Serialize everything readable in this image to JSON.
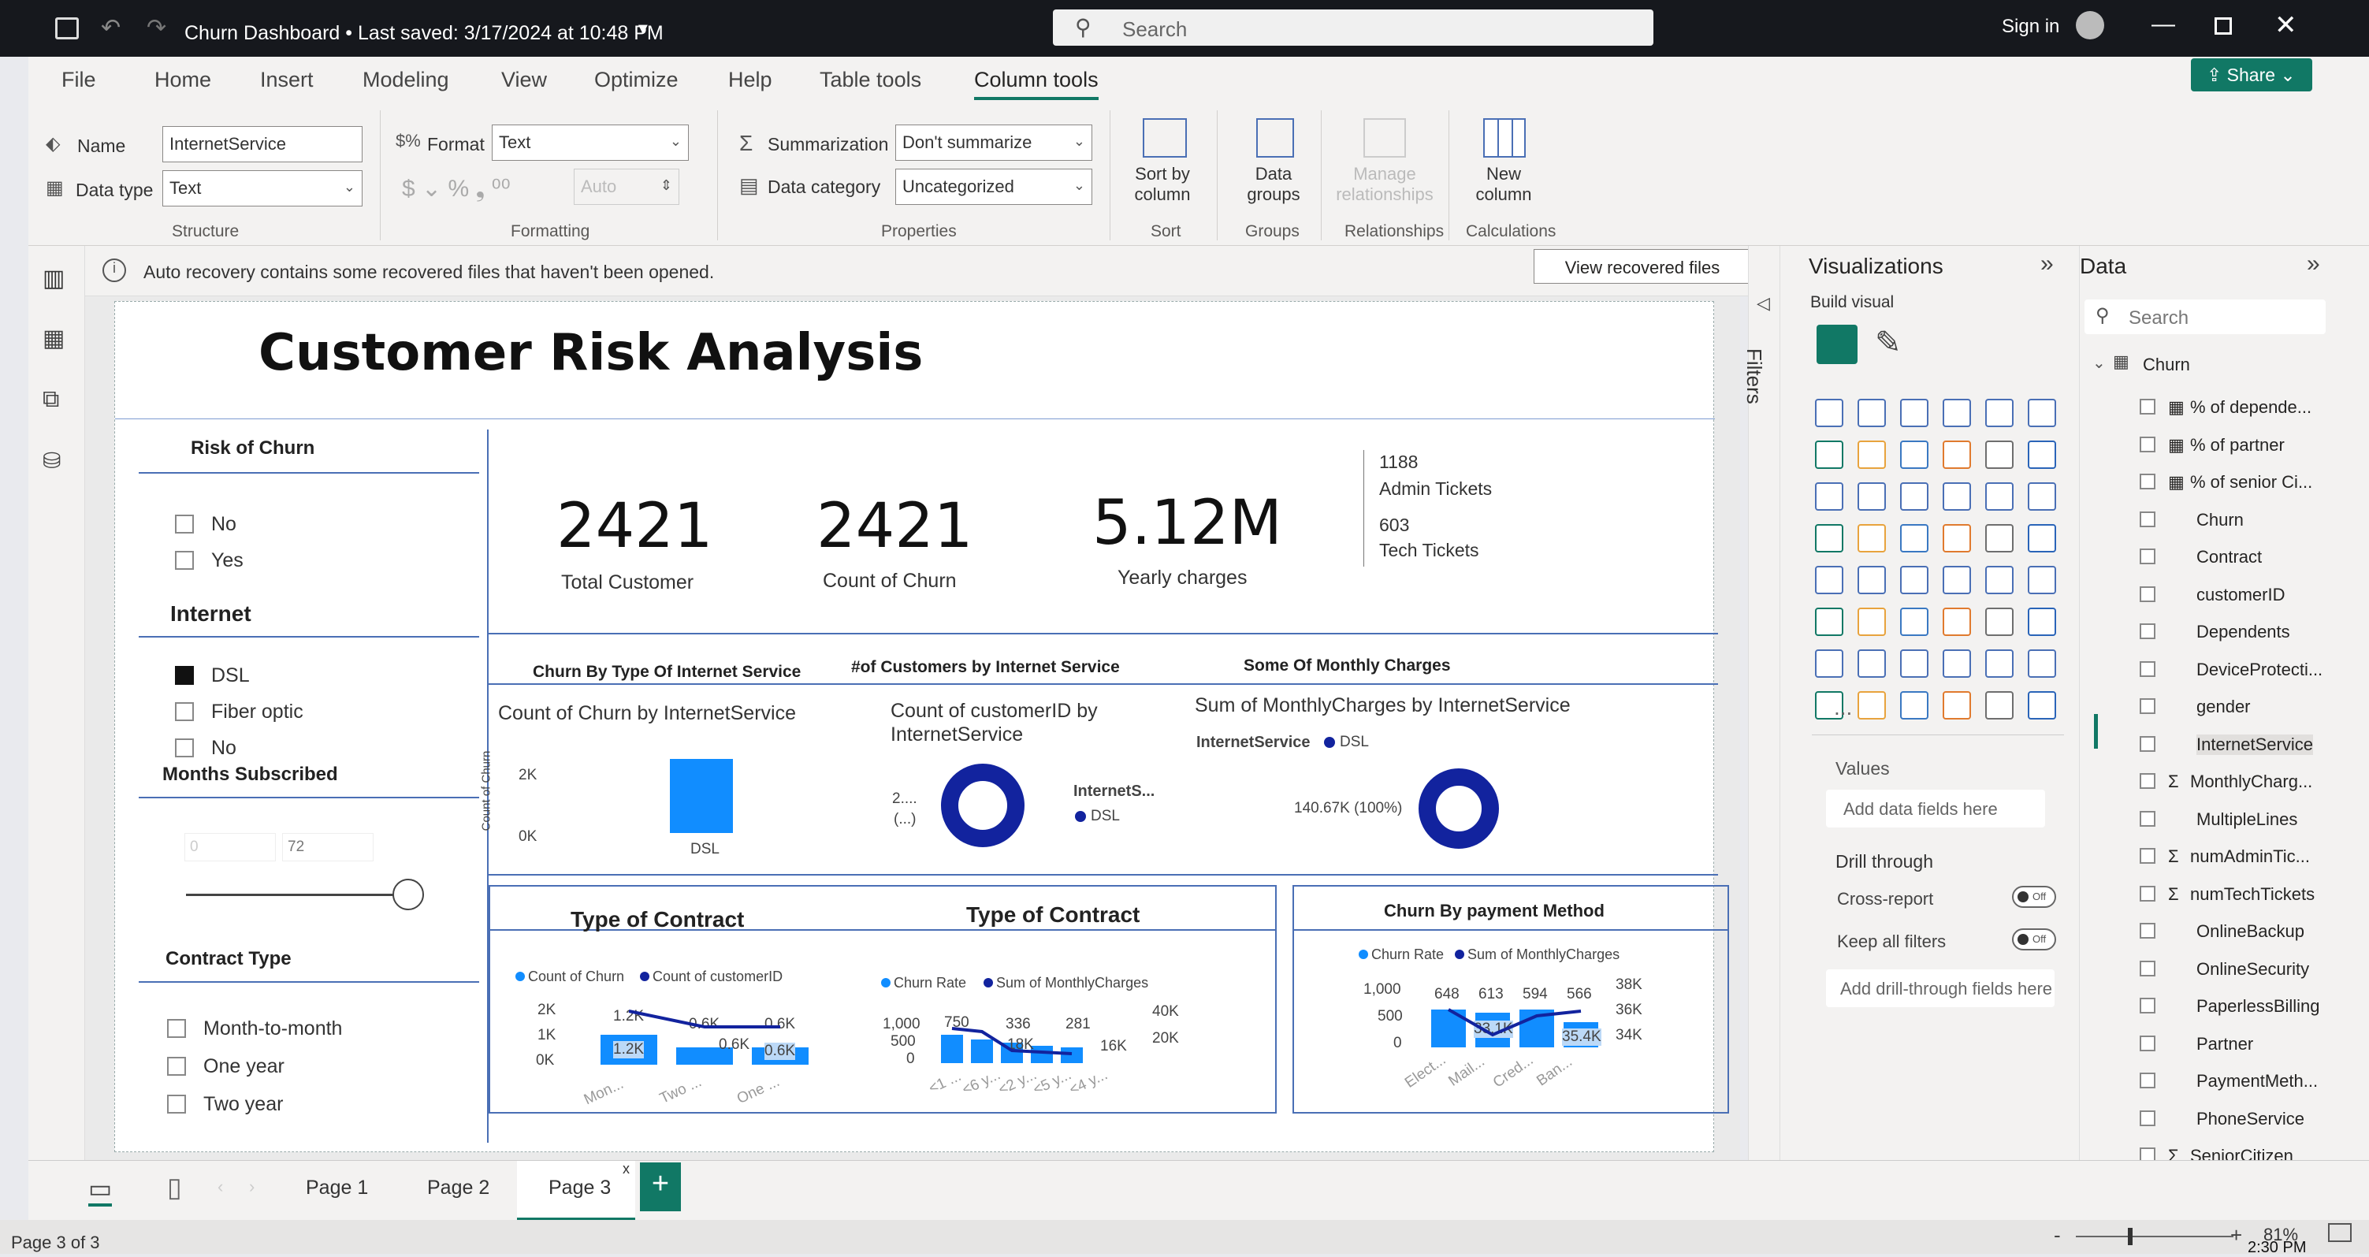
{
  "window": {
    "title": "Churn Dashboard • Last saved: 3/17/2024 at 10:48 PM",
    "search_placeholder": "Search",
    "sign_in": "Sign in",
    "share": "Share"
  },
  "ribbon": {
    "tabs": [
      "File",
      "Home",
      "Insert",
      "Modeling",
      "View",
      "Optimize",
      "Help",
      "Table tools",
      "Column tools"
    ],
    "name_label": "Name",
    "name_value": "InternetService",
    "datatype_label": "Data type",
    "datatype_value": "Text",
    "format_label": "Format",
    "format_value": "Text",
    "auto_value": "Auto",
    "summarization_label": "Summarization",
    "summarization_value": "Don't summarize",
    "category_label": "Data category",
    "category_value": "Uncategorized",
    "sort_label": "Sort by column",
    "groups_label": "Data groups",
    "relationships_label": "Manage relationships",
    "newcol_label": "New column",
    "group_labels": [
      "Structure",
      "Formatting",
      "Properties",
      "Sort",
      "Groups",
      "Relationships",
      "Calculations"
    ]
  },
  "infobar": {
    "message": "Auto recovery contains some recovered files that haven't been opened.",
    "button": "View recovered files"
  },
  "report": {
    "title": "Customer Risk Analysis",
    "slicers": {
      "risk_title": "Risk of Churn",
      "risk_items": [
        "No",
        "Yes"
      ],
      "internet_title": "Internet",
      "internet_items": [
        "DSL",
        "Fiber optic",
        "No"
      ],
      "months_title": "Months Subscribed",
      "months_min": "0",
      "months_max": "72",
      "contract_title": "Contract Type",
      "contract_items": [
        "Month-to-month",
        "One year",
        "Two year"
      ]
    },
    "kpis": {
      "total_customer_value": "2421",
      "total_customer_label": "Total Customer",
      "count_churn_value": "2421",
      "count_churn_label": "Count of Churn",
      "yearly_value": "5.12M",
      "yearly_label": "Yearly charges",
      "admin_value": "1188",
      "admin_label": "Admin Tickets",
      "tech_value": "603",
      "tech_label": "Tech Tickets"
    },
    "section_titles": {
      "churn_internet": "Churn By Type Of Internet Service",
      "customers_internet": "#of Customers by Internet Service",
      "monthly_charges": "Some Of Monthly Charges",
      "contract1": "Type of Contract",
      "contract2": "Type of Contract",
      "payment": "Churn By payment Method"
    },
    "visual1": {
      "title": "Count of Churn by InternetService",
      "ylabel": "Count of Churn",
      "ticks": [
        "2K",
        "0K"
      ],
      "category": "DSL"
    },
    "visual2": {
      "title": "Count of customerID by InternetService",
      "left_label": "2....",
      "left_sub": "(...)",
      "legend_title": "InternetS...",
      "legend_item": "DSL"
    },
    "visual3": {
      "title": "Sum of MonthlyCharges by InternetService",
      "legend_title": "InternetService",
      "legend_item": "DSL",
      "value_label": "140.67K (100%)"
    },
    "visual4": {
      "legend": [
        "Count of Churn",
        "Count of customerID"
      ],
      "yticks": [
        "2K",
        "1K",
        "0K"
      ],
      "top_labels": [
        "1.2K",
        "0.6K",
        "0.6K"
      ],
      "bar_labels": [
        "1.2K",
        "0.6K",
        "0.6K"
      ],
      "categories": [
        "Mon...",
        "Two ...",
        "One ..."
      ]
    },
    "visual5": {
      "legend": [
        "Churn Rate",
        "Sum of MonthlyCharges"
      ],
      "yticks_left": [
        "1,000",
        "500",
        "0"
      ],
      "yticks_right": [
        "40K",
        "20K"
      ],
      "top_labels": [
        "750",
        "336",
        "281"
      ],
      "bar_labels": [
        "18K",
        "16K"
      ],
      "categories": [
        "<1 ...",
        "<6 y...",
        "<2 y...",
        "<5 y...",
        "<4 y..."
      ]
    },
    "visual6": {
      "legend": [
        "Churn Rate",
        "Sum of MonthlyCharges"
      ],
      "yticks_left": [
        "1,000",
        "500",
        "0"
      ],
      "yticks_right": [
        "38K",
        "36K",
        "34K"
      ],
      "top_labels": [
        "648",
        "613",
        "594",
        "566"
      ],
      "bar_labels": [
        "33.1K",
        "35.4K"
      ],
      "categories": [
        "Elect...",
        "Mail...",
        "Cred...",
        "Ban..."
      ]
    }
  },
  "filters_label": "Filters",
  "visualizations": {
    "title": "Visualizations",
    "build": "Build visual",
    "values_label": "Values",
    "values_placeholder": "Add data fields here",
    "drill_label": "Drill through",
    "cross_report": "Cross-report",
    "keep_filters": "Keep all filters",
    "toggle_off": "Off",
    "drill_placeholder": "Add drill-through fields here",
    "more": "..."
  },
  "data_pane": {
    "title": "Data",
    "search_placeholder": "Search",
    "table": "Churn",
    "fields": [
      "% of depende...",
      "% of partner",
      "% of senior Ci...",
      "Churn",
      "Contract",
      "customerID",
      "Dependents",
      "DeviceProtecti...",
      "gender",
      "InternetService",
      "MonthlyCharg...",
      "MultipleLines",
      "numAdminTic...",
      "numTechTickets",
      "OnlineBackup",
      "OnlineSecurity",
      "PaperlessBilling",
      "Partner",
      "PaymentMeth...",
      "PhoneService",
      "SeniorCitizen"
    ]
  },
  "pages": [
    "Page 1",
    "Page 2",
    "Page 3"
  ],
  "status": {
    "page": "Page 3 of 3",
    "zoom": "81%",
    "time": "2:30 PM"
  },
  "colors": {
    "accent": "#117865",
    "bar": "#118dff",
    "navy": "#12239e",
    "titlebar": "#16181d"
  }
}
